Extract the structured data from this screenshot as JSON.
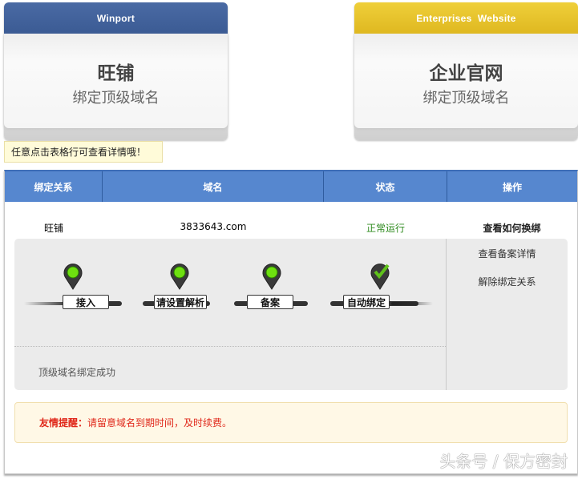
{
  "cards": [
    {
      "header": "Winport",
      "title": "旺铺",
      "subtitle": "绑定顶级域名"
    },
    {
      "header": "Enterprises  Website",
      "title": "企业官网",
      "subtitle": "绑定顶级域名"
    }
  ],
  "tip": "任意点击表格行可查看详情哦！",
  "table": {
    "headers": [
      "绑定关系",
      "域名",
      "状态",
      "操作"
    ],
    "row": {
      "relation": "旺铺",
      "domain": "3833643.com",
      "status": "正常运行",
      "action": "查看如何换绑"
    },
    "steps": [
      "接入",
      "请设置解析",
      "备案",
      "自动绑定"
    ],
    "result": "顶级域名绑定成功",
    "ops": [
      "查看备案详情",
      "解除绑定关系"
    ]
  },
  "notice": {
    "label": "友情提醒：",
    "text": "请留意域名到期时间，及时续费。"
  },
  "watermark": "头条号 / 保方密封",
  "colors": {
    "blue": "#5687cf",
    "yellow": "#e6c12a",
    "status": "#2e8b1e",
    "alert": "#e0281a"
  }
}
